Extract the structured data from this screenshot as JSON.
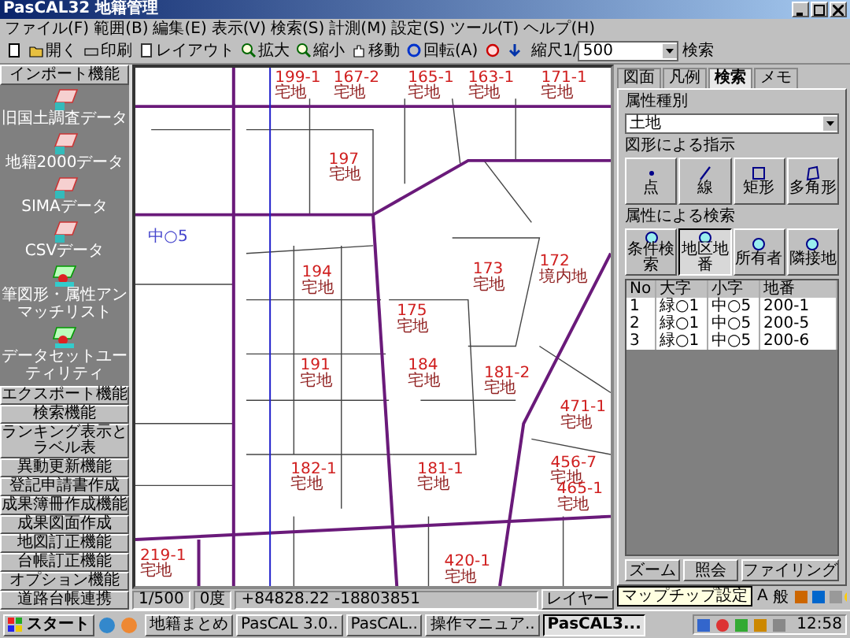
{
  "window": {
    "title": "PasCAL32 地籍管理"
  },
  "menu": [
    "ファイル(F)",
    "範囲(B)",
    "編集(E)",
    "表示(V)",
    "検索(S)",
    "計測(M)",
    "設定(S)",
    "ツール(T)",
    "ヘルプ(H)"
  ],
  "toolbar": {
    "buttons": [
      {
        "kind": "new"
      },
      {
        "kind": "open",
        "label": "開く"
      },
      {
        "kind": "print",
        "label": "印刷"
      },
      {
        "kind": "layout",
        "label": "レイアウト"
      },
      {
        "kind": "zoomin",
        "label": "拡大"
      },
      {
        "kind": "zoomout",
        "label": "縮小"
      },
      {
        "kind": "hand",
        "label": "移動"
      },
      {
        "kind": "rotate",
        "label": "回転(A)"
      },
      {
        "kind": "target"
      },
      {
        "kind": "down"
      }
    ],
    "scale_label": "縮尺1/",
    "scale_value": "500",
    "search": "検索"
  },
  "import_panel": {
    "title": "インポート機能",
    "items": [
      {
        "kind": "grid",
        "label": "旧国土調査データ"
      },
      {
        "kind": "grid",
        "label": "地籍2000データ"
      },
      {
        "kind": "grid",
        "label": "SIMAデータ"
      },
      {
        "kind": "grid",
        "label": "CSVデータ"
      },
      {
        "kind": "shapes",
        "label": "筆図形・属性アンマッチリスト"
      },
      {
        "kind": "shapes",
        "label": "データセットユーティリティ"
      }
    ]
  },
  "function_buttons": [
    "エクスポート機能",
    "検索機能",
    "ランキング表示とラベル表",
    "異動更新機能",
    "登記申請書作成",
    "成果簿冊作成機能",
    "成果図面作成",
    "地図訂正機能",
    "台帳訂正機能",
    "オプション機能",
    "道路台帳連携"
  ],
  "map": {
    "district_label": "中○5",
    "parcels": [
      {
        "number": "199-1",
        "use": "宅地"
      },
      {
        "number": "167-2",
        "use": "宅地"
      },
      {
        "number": "165-1",
        "use": "宅地"
      },
      {
        "number": "163-1",
        "use": "宅地"
      },
      {
        "number": "171-1",
        "use": "宅地"
      },
      {
        "number": "197",
        "use": "宅地"
      },
      {
        "number": "194",
        "use": "宅地"
      },
      {
        "number": "172",
        "use": "境内地"
      },
      {
        "number": "175",
        "use": "宅地"
      },
      {
        "number": "173",
        "use": "宅地"
      },
      {
        "number": "191",
        "use": "宅地"
      },
      {
        "number": "184",
        "use": "宅地"
      },
      {
        "number": "181-2",
        "use": "宅地"
      },
      {
        "number": "471-1",
        "use": "宅地"
      },
      {
        "number": "182-1",
        "use": "宅地"
      },
      {
        "number": "181-1",
        "use": "宅地"
      },
      {
        "number": "456-7",
        "use": "宅地"
      },
      {
        "number": "219-1",
        "use": "宅地"
      },
      {
        "number": "420-1",
        "use": "宅地"
      },
      {
        "number": "465-1",
        "use": "宅地"
      }
    ]
  },
  "right_panel": {
    "tabs": [
      {
        "label": "図面",
        "selected": false
      },
      {
        "label": "凡例",
        "selected": false
      },
      {
        "label": "検索",
        "selected": true
      },
      {
        "label": "メモ",
        "selected": false
      }
    ],
    "attribute_type": {
      "label": "属性種別",
      "value": "土地"
    },
    "shape_group": {
      "title": "図形による指示",
      "buttons": [
        {
          "kind": "point",
          "label": "点"
        },
        {
          "kind": "line",
          "label": "線"
        },
        {
          "kind": "rect",
          "label": "矩形"
        },
        {
          "kind": "polygon",
          "label": "多角形"
        }
      ]
    },
    "attr_group": {
      "title": "属性による検索",
      "buttons": [
        {
          "label": "条件検索",
          "selected": false
        },
        {
          "label": "地区地番",
          "selected": true
        },
        {
          "label": "所有者",
          "selected": false
        },
        {
          "label": "隣接地",
          "selected": false
        }
      ]
    },
    "results": {
      "columns": [
        "No",
        "大字",
        "小字",
        "地番"
      ],
      "rows": [
        [
          "1",
          "緑○1",
          "中○5",
          "200-1"
        ],
        [
          "2",
          "緑○1",
          "中○5",
          "200-5"
        ],
        [
          "3",
          "緑○1",
          "中○5",
          "200-6"
        ]
      ]
    },
    "actions": [
      "ズーム",
      "照会",
      "ファイリング"
    ]
  },
  "tooltip": "マップチップ設定",
  "layer_button": "レイヤー",
  "mini_toolbar": [
    "A",
    "般"
  ],
  "status_bar": {
    "scale": "1/500",
    "angle": "0度",
    "coords": "+84828.22  -18803851"
  },
  "taskbar": {
    "start": "スタート",
    "tasks": [
      {
        "label": "地籍まとめ",
        "selected": false
      },
      {
        "label": "PasCAL 3.0..",
        "selected": false
      },
      {
        "label": "PasCAL..",
        "selected": false
      },
      {
        "label": "操作マニュア..",
        "selected": false
      },
      {
        "label": "PasCAL3...",
        "selected": true
      }
    ],
    "clock": "12:58"
  }
}
